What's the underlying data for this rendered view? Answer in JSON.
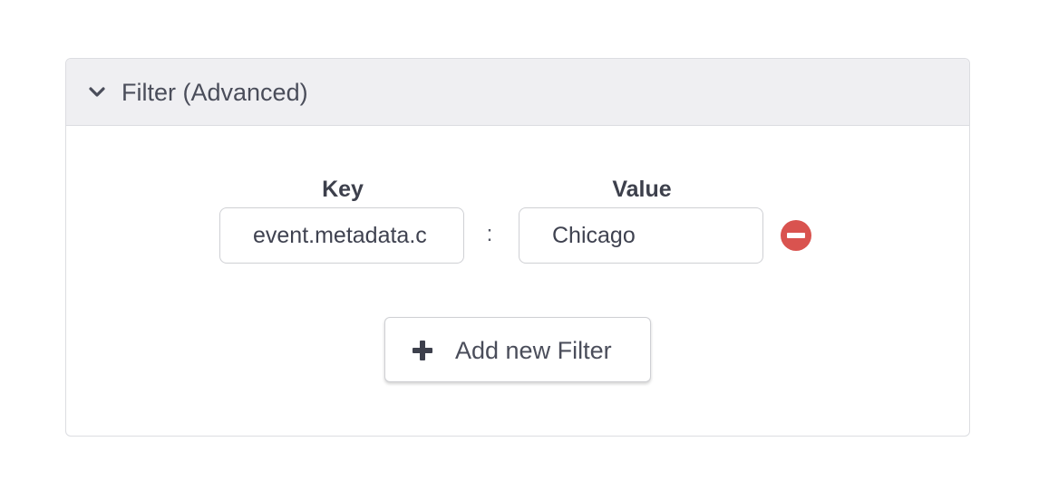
{
  "panel": {
    "title": "Filter (Advanced)",
    "expand_icon": "chevron-down-icon"
  },
  "filters": [
    {
      "key_label": "Key",
      "value_label": "Value",
      "key": "event.metadata.c",
      "separator": ":",
      "value": "Chicago",
      "remove_icon": "minus-circle-icon"
    }
  ],
  "add_button": {
    "label": "Add new Filter",
    "icon": "plus-icon"
  },
  "colors": {
    "header_bg": "#efeff2",
    "border": "#dcdde1",
    "text": "#4a4d5a",
    "remove": "#d9534f"
  }
}
